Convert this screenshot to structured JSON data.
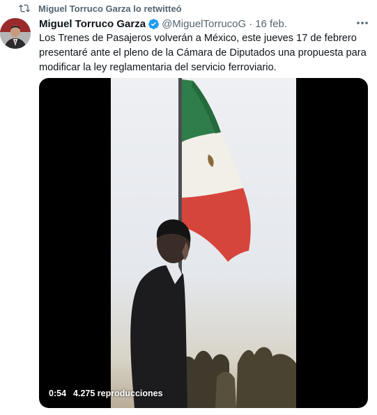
{
  "retweet": {
    "icon": "retweet-icon",
    "text": "Miguel Torruco Garza lo retwitteó"
  },
  "tweet": {
    "author": {
      "name": "Miguel Torruco Garza",
      "handle": "@MiguelTorrucoG",
      "verified": true
    },
    "separator": "·",
    "date": "16 feb.",
    "text": "Los Trenes de Pasajeros volverán a México, este jueves 17 de febrero presentaré ante el pleno de la Cámara de Diputados una propuesta para modificar la ley reglamentaria del servicio ferroviario.",
    "video": {
      "duration": "0:54",
      "views": "4.275 reproducciones"
    }
  },
  "colors": {
    "secondary_text": "#536471",
    "verified_blue": "#1d9bf0",
    "flag_green": "#2f7d4a",
    "flag_red": "#d6453c"
  }
}
